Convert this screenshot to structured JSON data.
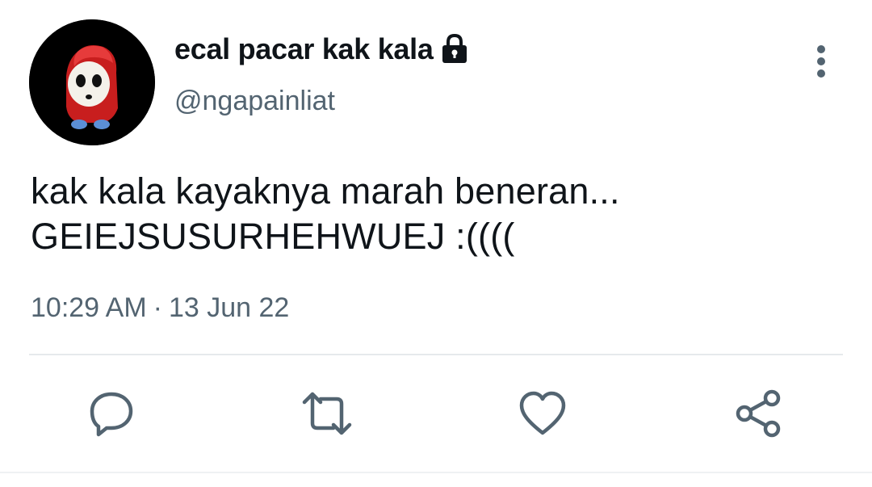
{
  "user": {
    "display_name": "ecal pacar kak kala",
    "handle": "@ngapainliat",
    "protected_icon": "lock-icon",
    "avatar": "avatar-shy-guy"
  },
  "tweet": {
    "lines": [
      "kak kala kayaknya marah beneran...",
      "GEIEJSUSURHEHWUEJ :(((("
    ],
    "time": "10:29 AM",
    "separator": "·",
    "date": "13 Jun 22"
  },
  "actions": {
    "reply": "reply-icon",
    "retweet": "retweet-icon",
    "like": "like-icon",
    "share": "share-icon",
    "more": "more-options-icon"
  },
  "colors": {
    "text": "#0f1419",
    "secondary": "#536471",
    "divider": "#e6e9ec",
    "avatar_bg": "#000000",
    "avatar_hood": "#d62828"
  }
}
